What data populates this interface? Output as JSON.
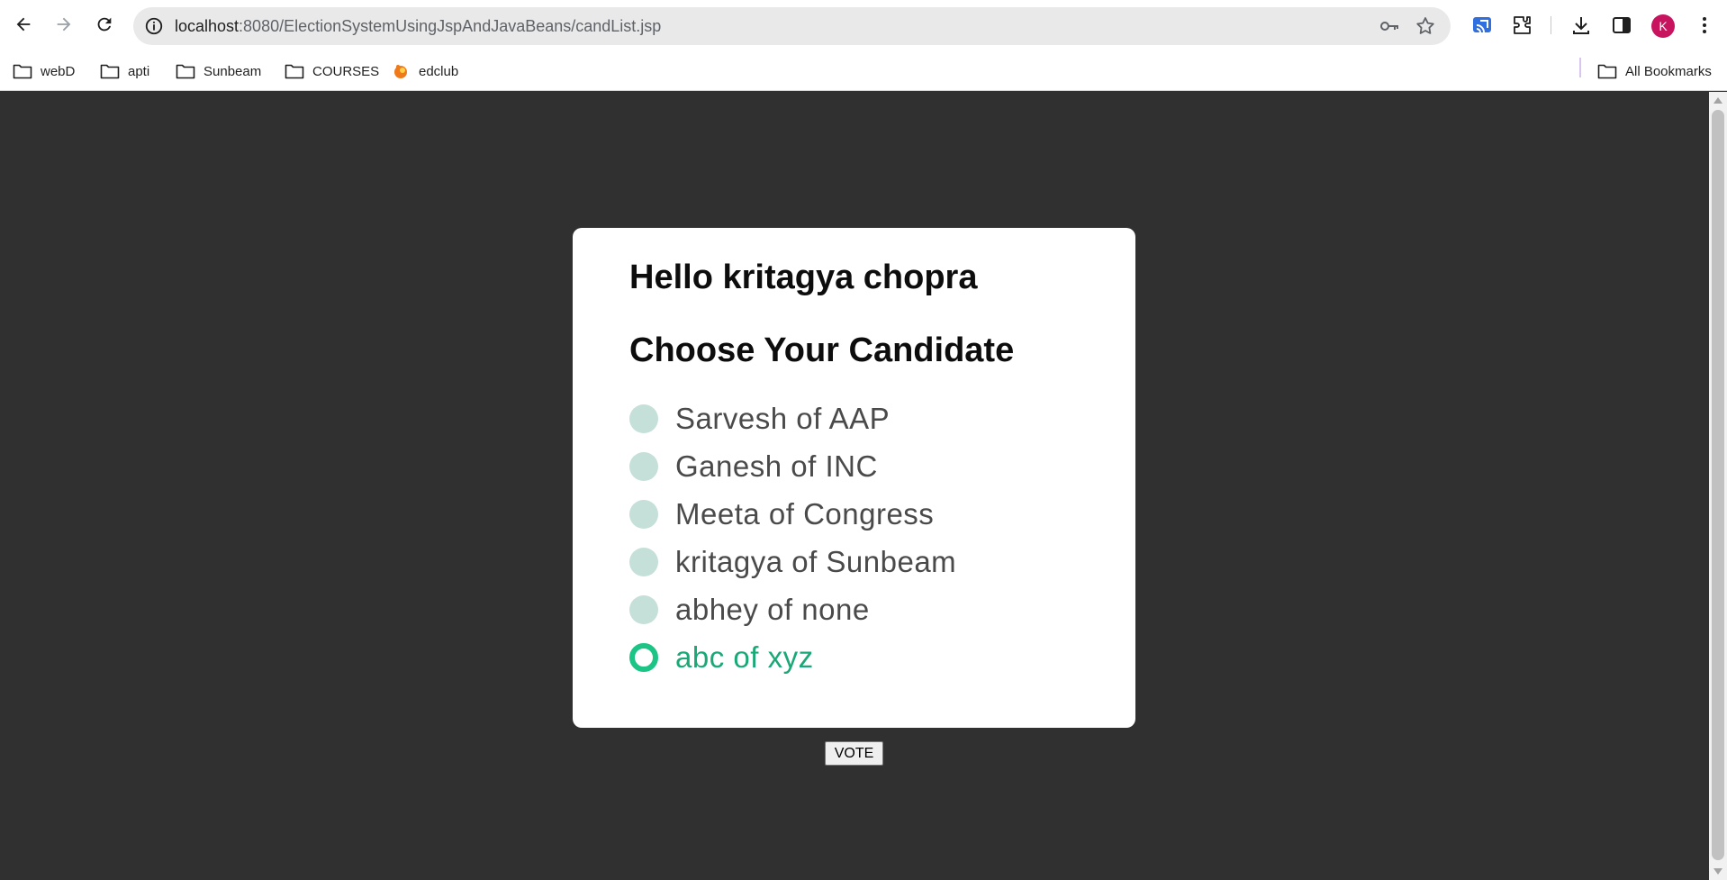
{
  "browser": {
    "url_host": "localhost",
    "url_path": ":8080/ElectionSystemUsingJspAndJavaBeans/candList.jsp",
    "avatar_letter": "K",
    "bookmarks": [
      {
        "label": "webD",
        "icon": "folder-icon"
      },
      {
        "label": "apti",
        "icon": "folder-icon"
      },
      {
        "label": "Sunbeam",
        "icon": "folder-icon"
      },
      {
        "label": "COURSES",
        "icon": "folder-icon"
      },
      {
        "label": "edclub",
        "icon": "edclub-favicon"
      }
    ],
    "all_bookmarks_label": "All Bookmarks"
  },
  "page": {
    "greeting": "Hello kritagya chopra",
    "heading": "Choose Your Candidate",
    "candidates": [
      {
        "label": "Sarvesh of AAP",
        "selected": false
      },
      {
        "label": "Ganesh of INC",
        "selected": false
      },
      {
        "label": "Meeta of Congress",
        "selected": false
      },
      {
        "label": "kritagya of Sunbeam",
        "selected": false
      },
      {
        "label": "abhey of none",
        "selected": false
      },
      {
        "label": "abc of xyz",
        "selected": true
      }
    ],
    "vote_label": "VOTE"
  },
  "colors": {
    "page_background": "#303030",
    "card_background": "#ffffff",
    "radio_unchecked": "#c5e0d8",
    "radio_checked": "#1cc486",
    "selected_label": "#1aa876",
    "avatar": "#c8135f"
  }
}
